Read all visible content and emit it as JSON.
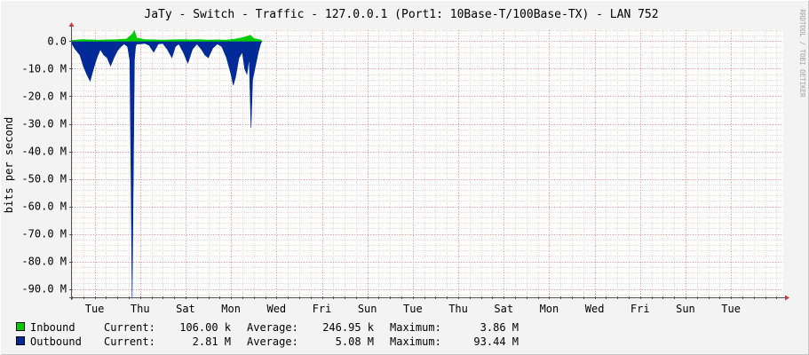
{
  "chart_data": {
    "type": "area",
    "title": "JaTy - Switch - Traffic - 127.0.0.1 (Port1: 10Base-T/100Base-TX) - LAN 752",
    "ylabel": "bits per second",
    "watermark": "RRDTOOL / TOBI OETIKER",
    "y_ticks": [
      "0.0",
      "-10.0 M",
      "-20.0 M",
      "-30.0 M",
      "-40.0 M",
      "-50.0 M",
      "-60.0 M",
      "-70.0 M",
      "-80.0 M",
      "-90.0 M"
    ],
    "y_tick_values": [
      0,
      -10,
      -20,
      -30,
      -40,
      -50,
      -60,
      -70,
      -80,
      -90
    ],
    "ylim": [
      -93,
      4
    ],
    "y_unit_scale": "M",
    "x_ticks": [
      "Tue",
      "Thu",
      "Sat",
      "Mon",
      "Wed",
      "Fri",
      "Sun",
      "Tue",
      "Thu",
      "Sat",
      "Mon",
      "Wed",
      "Fri",
      "Sun",
      "Tue"
    ],
    "x_tick_days": [
      1,
      3,
      5,
      7,
      9,
      11,
      13,
      15,
      17,
      19,
      21,
      23,
      25,
      27,
      29
    ],
    "xlim_days": [
      0,
      31.3
    ],
    "grid": true,
    "legend_position": "bottom-left",
    "colors": {
      "inbound": "#00cc00",
      "outbound": "#002a97",
      "grid": "#e9a1a1",
      "axis": "#555555",
      "arrow": "#c44040",
      "plot_bg": "#ffffff",
      "canvas_bg": "#f3f3f3"
    },
    "series": [
      {
        "name": "Inbound",
        "x_days": [
          0,
          0.4,
          0.8,
          1.2,
          1.6,
          2.0,
          2.4,
          2.65,
          2.75,
          2.85,
          3.2,
          3.6,
          4.0,
          4.4,
          4.8,
          5.2,
          5.6,
          6.0,
          6.4,
          6.8,
          7.2,
          7.6,
          7.85,
          8.0,
          8.3,
          8.35,
          8.36
        ],
        "values": [
          0.3,
          0.6,
          0.5,
          0.4,
          0.5,
          0.6,
          0.8,
          2.5,
          3.86,
          1.2,
          0.6,
          0.5,
          0.4,
          0.5,
          0.6,
          0.5,
          0.6,
          0.4,
          0.5,
          0.4,
          0.8,
          1.5,
          2.2,
          1.0,
          0.5,
          0.1,
          0
        ]
      },
      {
        "name": "Outbound",
        "x_days": [
          0,
          0.15,
          0.35,
          0.5,
          0.65,
          0.8,
          0.95,
          1.1,
          1.25,
          1.4,
          1.55,
          1.7,
          1.85,
          2.0,
          2.15,
          2.3,
          2.45,
          2.55,
          2.65,
          2.75,
          2.8,
          2.85,
          3.0,
          3.2,
          3.4,
          3.6,
          3.8,
          4.0,
          4.2,
          4.4,
          4.55,
          4.7,
          4.9,
          5.1,
          5.3,
          5.5,
          5.7,
          5.85,
          6.0,
          6.2,
          6.4,
          6.6,
          6.8,
          7.0,
          7.1,
          7.2,
          7.35,
          7.5,
          7.6,
          7.7,
          7.8,
          7.88,
          7.95,
          8.05,
          8.2,
          8.3,
          8.36
        ],
        "values": [
          -1.0,
          -3.0,
          -5.0,
          -9.0,
          -12.0,
          -14.5,
          -10.0,
          -6.0,
          -3.0,
          -5.0,
          -6.0,
          -9.0,
          -6.0,
          -3.5,
          -2.0,
          -1.0,
          -2.0,
          -7.0,
          -93.44,
          -7.0,
          -2.0,
          -1.0,
          -1.0,
          -0.8,
          -1.5,
          -4.0,
          -1.0,
          -0.8,
          -3.0,
          -6.0,
          -2.0,
          -1.0,
          -4.0,
          -8.0,
          -3.0,
          -1.0,
          -3.0,
          -5.0,
          -6.0,
          -2.5,
          -1.0,
          -2.0,
          -6.0,
          -12.0,
          -16.0,
          -13.0,
          -6.0,
          -4.0,
          -10.0,
          -12.0,
          -6.0,
          -31.5,
          -14.0,
          -10.0,
          -4.0,
          -1.0,
          0
        ]
      }
    ],
    "legend": [
      {
        "name": "Inbound",
        "current": "106.00 k",
        "average": "246.95 k",
        "maximum": "3.86 M"
      },
      {
        "name": "Outbound",
        "current": "2.81 M",
        "average": "5.08 M",
        "maximum": "93.44 M"
      }
    ],
    "legend_labels": {
      "current": "Current:",
      "average": "Average:",
      "maximum": "Maximum:"
    }
  }
}
